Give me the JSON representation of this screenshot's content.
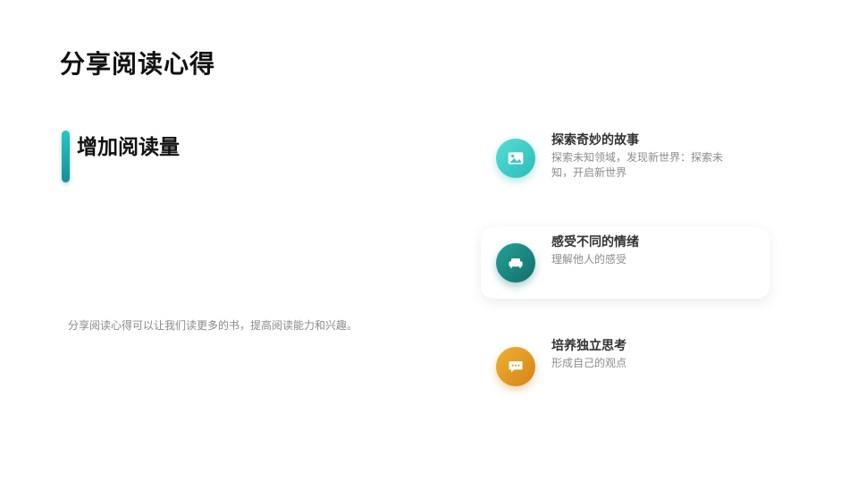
{
  "page": {
    "title": "分享阅读心得"
  },
  "section": {
    "title": "增加阅读量",
    "summary": "分享阅读心得可以让我们读更多的书，提高阅读能力和兴趣。"
  },
  "features": [
    {
      "title": "探索奇妙的故事",
      "description": "探索未知领域，发现新世界：探索未知，开启新世界",
      "icon": "image-icon",
      "color": "#35c9c3"
    },
    {
      "title": "感受不同的情绪",
      "description": "理解他人的感受",
      "icon": "armchair-icon",
      "color": "#1a8a84"
    },
    {
      "title": "培养独立思考",
      "description": "形成自己的观点",
      "icon": "chat-bubble-icon",
      "color": "#e09a26"
    }
  ]
}
